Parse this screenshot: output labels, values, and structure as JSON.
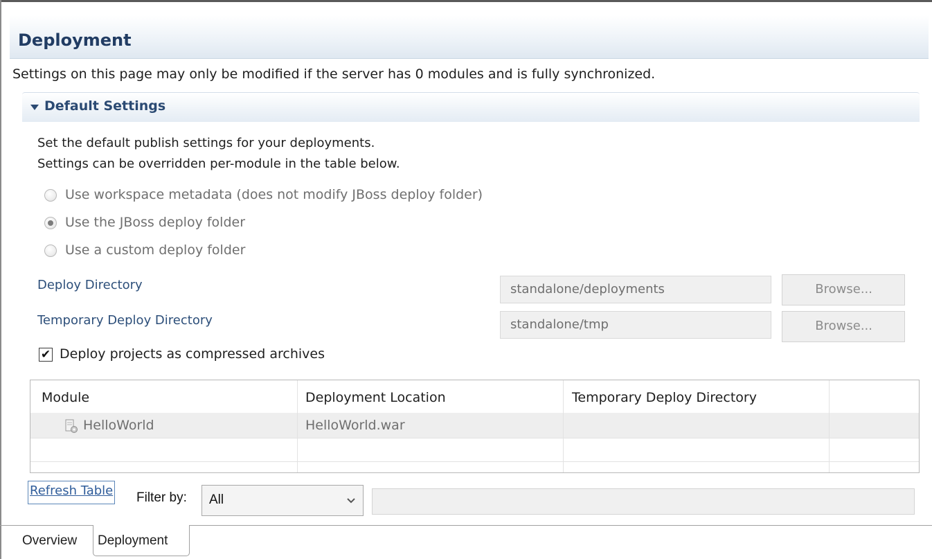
{
  "page": {
    "title": "Deployment",
    "notice": "Settings on this page may only be modified if the server has 0 modules and is fully synchronized."
  },
  "default_settings": {
    "section_title": "Default Settings",
    "expanded": true,
    "description_line1": "Set the default publish settings for your deployments.",
    "description_line2": "Settings can be overridden per-module in the table below.",
    "radios": [
      {
        "label": "Use workspace metadata (does not modify JBoss deploy folder)",
        "selected": false,
        "enabled": false
      },
      {
        "label": "Use the JBoss deploy folder",
        "selected": true,
        "enabled": false
      },
      {
        "label": "Use a custom deploy folder",
        "selected": false,
        "enabled": false
      }
    ],
    "deploy_directory": {
      "label": "Deploy Directory",
      "value": "standalone/deployments",
      "browse_label": "Browse..."
    },
    "temp_deploy_directory": {
      "label": "Temporary Deploy Directory",
      "value": "standalone/tmp",
      "browse_label": "Browse..."
    },
    "compress_archives": {
      "label": "Deploy projects as compressed archives",
      "checked": true,
      "check_glyph": "✔"
    }
  },
  "module_table": {
    "columns": [
      "Module",
      "Deployment Location",
      "Temporary Deploy Directory"
    ],
    "rows": [
      {
        "module": "HelloWorld",
        "icon": "module-icon",
        "deployment_location": "HelloWorld.war",
        "temp_dir": ""
      }
    ]
  },
  "footer": {
    "refresh_label": "Refresh Table",
    "filter_label": "Filter by:",
    "filter_value": "All",
    "filter_text": ""
  },
  "tabs": [
    {
      "label": "Overview",
      "active": false
    },
    {
      "label": "Deployment",
      "active": true
    }
  ],
  "colors": {
    "title": "#213c63",
    "section_title": "#2b4a73",
    "link": "#2d4f7a",
    "disabled_text": "#6f6f6f"
  }
}
